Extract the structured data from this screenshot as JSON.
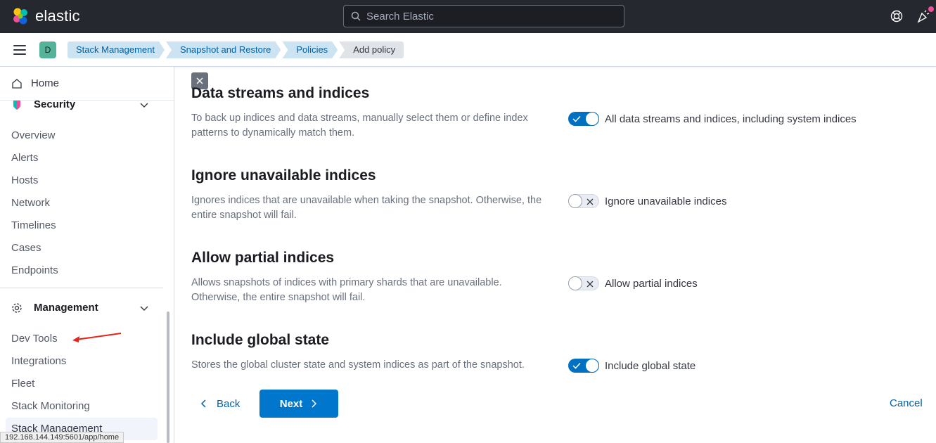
{
  "header": {
    "brand": "elastic",
    "search_placeholder": "Search Elastic"
  },
  "subheader": {
    "space_initial": "D",
    "breadcrumbs": [
      "Stack Management",
      "Snapshot and Restore",
      "Policies",
      "Add policy"
    ]
  },
  "sidebar": {
    "home_label": "Home",
    "security_label": "Security",
    "security_items": [
      "Overview",
      "Alerts",
      "Hosts",
      "Network",
      "Timelines",
      "Cases",
      "Endpoints"
    ],
    "management_label": "Management",
    "management_items": [
      "Dev Tools",
      "Integrations",
      "Fleet",
      "Stack Monitoring",
      "Stack Management"
    ],
    "active_item": "Stack Management",
    "status_url": "192.168.144.149:5601/app/home"
  },
  "settings": [
    {
      "title": "Data streams and indices",
      "description": "To back up indices and data streams, manually select them or define index patterns to dynamically match them.",
      "toggle_label": "All data streams and indices, including system indices",
      "enabled": true
    },
    {
      "title": "Ignore unavailable indices",
      "description": "Ignores indices that are unavailable when taking the snapshot. Otherwise, the entire snapshot will fail.",
      "toggle_label": "Ignore unavailable indices",
      "enabled": false
    },
    {
      "title": "Allow partial indices",
      "description": "Allows snapshots of indices with primary shards that are unavailable. Otherwise, the entire snapshot will fail.",
      "toggle_label": "Allow partial indices",
      "enabled": false
    },
    {
      "title": "Include global state",
      "description": "Stores the global cluster state and system indices as part of the snapshot.",
      "toggle_label": "Include global state",
      "enabled": true
    }
  ],
  "footer": {
    "back_label": "Back",
    "next_label": "Next",
    "cancel_label": "Cancel"
  },
  "colors": {
    "header_bg": "#25282f",
    "primary": "#0077cc",
    "link": "#0061a6",
    "annotation_arrow": "#e7231b"
  }
}
